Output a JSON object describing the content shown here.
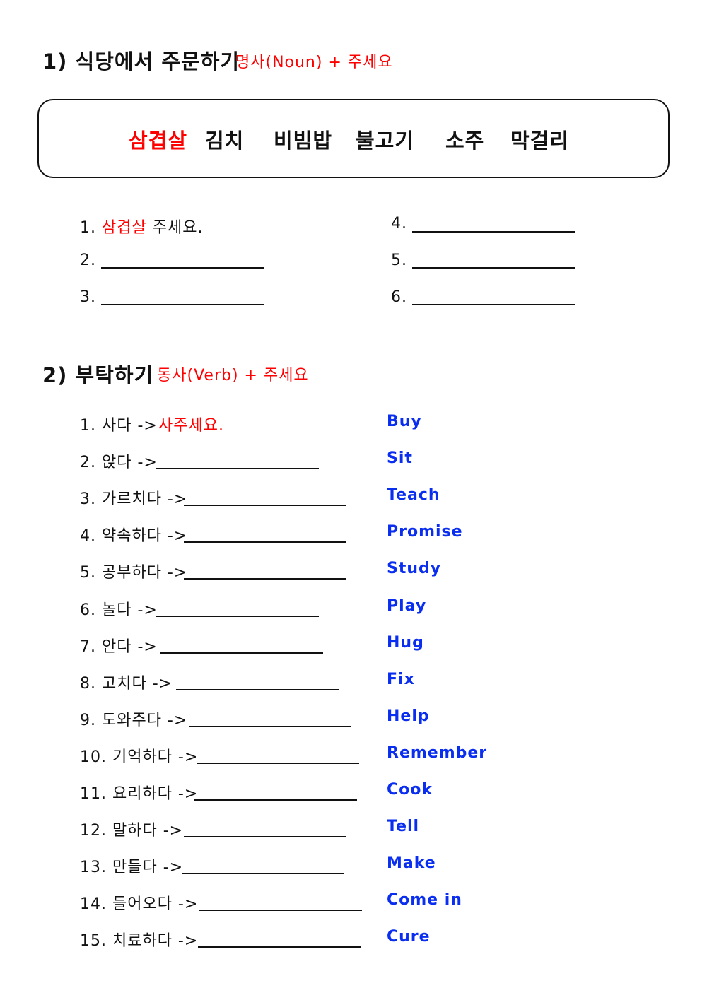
{
  "section1": {
    "title": "1) 식당에서 주문하기",
    "pattern": "명사(Noun) + 주세요",
    "word_bank": [
      "삼겹살",
      "김치",
      "비빔밥",
      "불고기",
      "소주",
      "막걸리"
    ],
    "example": {
      "number": "1.",
      "noun": "삼겹살",
      "suffix": "주세요."
    },
    "blanks": [
      "2.",
      "3.",
      "4.",
      "5.",
      "6."
    ]
  },
  "section2": {
    "title": "2) 부탁하기",
    "pattern": "동사(Verb) + 주세요",
    "items": [
      {
        "prompt": "1. 사다 ->",
        "answer": "사주세요.",
        "english": "Buy"
      },
      {
        "prompt": "2. 앉다 ->",
        "answer": "",
        "english": "Sit"
      },
      {
        "prompt": "3. 가르치다 ->",
        "answer": "",
        "english": "Teach"
      },
      {
        "prompt": "4. 약속하다 ->",
        "answer": "",
        "english": "Promise"
      },
      {
        "prompt": "5. 공부하다 ->",
        "answer": "",
        "english": "Study"
      },
      {
        "prompt": "6. 놀다 ->",
        "answer": "",
        "english": "Play"
      },
      {
        "prompt": "7. 안다 ->",
        "answer": "",
        "english": "Hug"
      },
      {
        "prompt": "8. 고치다 ->",
        "answer": "",
        "english": "Fix"
      },
      {
        "prompt": "9. 도와주다 ->",
        "answer": "",
        "english": "Help"
      },
      {
        "prompt": "10. 기억하다 ->",
        "answer": "",
        "english": "Remember"
      },
      {
        "prompt": "11. 요리하다 ->",
        "answer": "",
        "english": "Cook"
      },
      {
        "prompt": "12. 말하다 ->",
        "answer": "",
        "english": "Tell"
      },
      {
        "prompt": "13. 만들다 ->",
        "answer": "",
        "english": "Make"
      },
      {
        "prompt": "14. 들어오다 ->",
        "answer": "",
        "english": "Come in"
      },
      {
        "prompt": "15. 치료하다 ->",
        "answer": "",
        "english": "Cure"
      }
    ]
  },
  "colors": {
    "highlight": "#ff0000",
    "english": "#0a2ef0",
    "text": "#111111"
  }
}
